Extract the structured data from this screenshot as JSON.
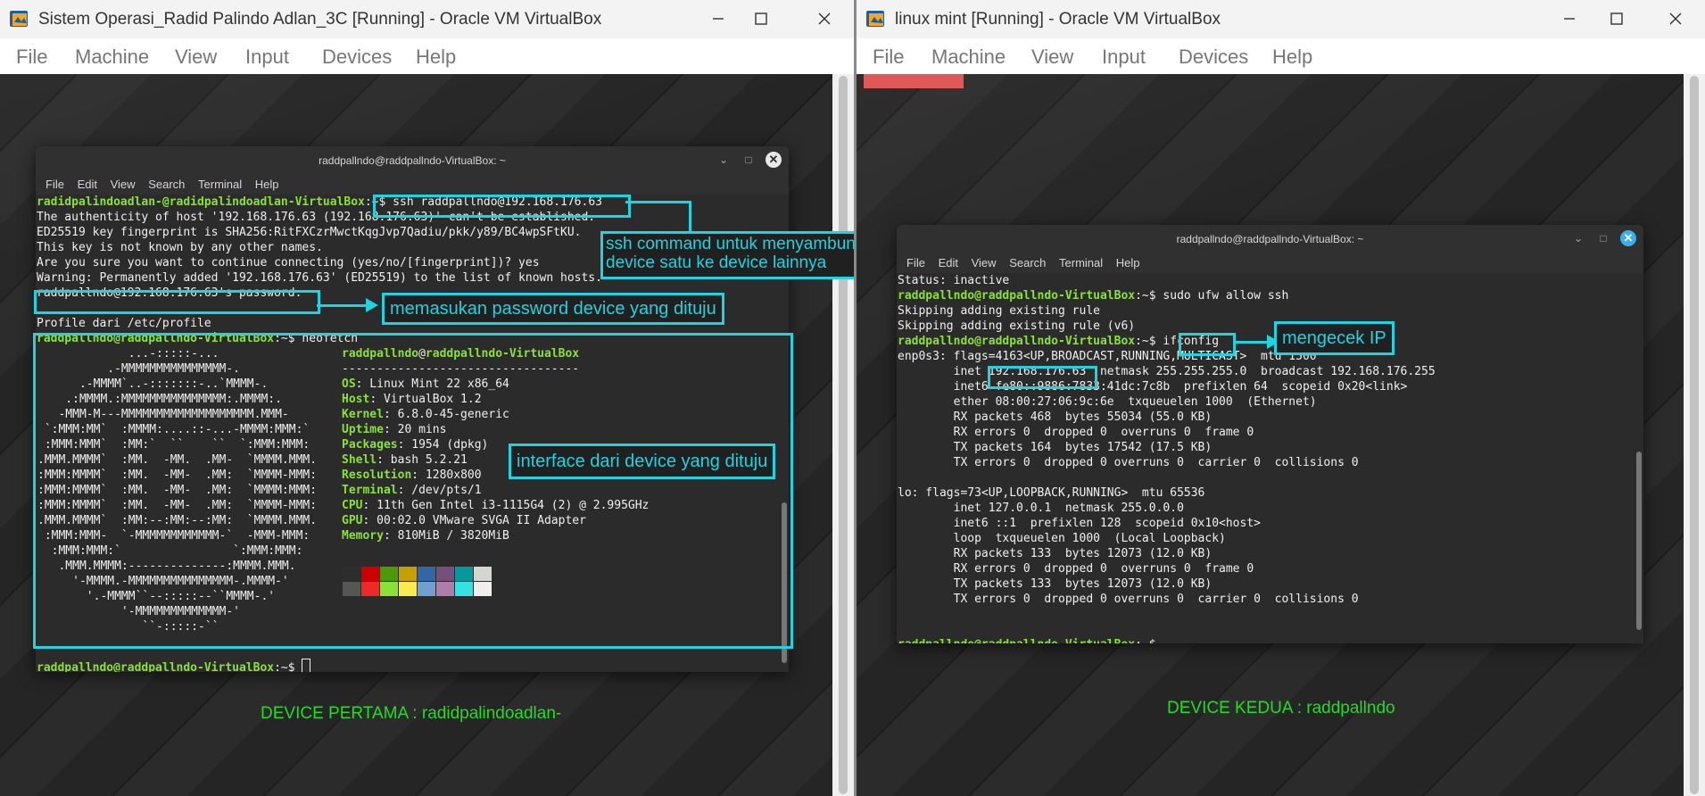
{
  "vm1": {
    "title": "Sistem Operasi_Radid Palindo Adlan_3C [Running] - Oracle VM VirtualBox",
    "menu": [
      "File",
      "Machine",
      "View",
      "Input",
      "Devices",
      "Help"
    ],
    "terminal": {
      "title": "raddpallndo@raddpallndo-VirtualBox: ~",
      "menu": [
        "File",
        "Edit",
        "View",
        "Search",
        "Terminal",
        "Help"
      ],
      "prompt_user1": "radidpalindoadlan-@radidpalindoadlan-VirtualBox",
      "prompt_sep": ":~$",
      "cmd_ssh": " ssh raddpallndo@192.168.176.63",
      "out1": "The authenticity of host '192.168.176.63 (192.168.176.63)' can't be established.",
      "out2": "ED25519 key fingerprint is SHA256:RitFXCzrMwctKqgJvp7Qadiu/pkk/y89/BC4wpSFtKU.",
      "out3": "This key is not known by any other names.",
      "out4": "Are you sure you want to continue connecting (yes/no/[fingerprint])? yes",
      "out5": "Warning: Permanently added '192.168.176.63' (ED25519) to the list of known hosts.",
      "out6": "raddpallndo@192.168.176.63's password:",
      "out7": "Profile dari /etc/profile",
      "prompt_user2": "raddpallndo@raddpallndo-VirtualBox",
      "cmd_neofetch": " neofetch",
      "neo_header_user": "raddpallndo",
      "neo_header_at": "@",
      "neo_header_host": "raddpallndo-VirtualBox",
      "neo_rule": "----------------------------------",
      "neo_info": [
        {
          "k": "OS",
          "v": ": Linux Mint 22 x86_64"
        },
        {
          "k": "Host",
          "v": ": VirtualBox 1.2"
        },
        {
          "k": "Kernel",
          "v": ": 6.8.0-45-generic"
        },
        {
          "k": "Uptime",
          "v": ": 20 mins"
        },
        {
          "k": "Packages",
          "v": ": 1954 (dpkg)"
        },
        {
          "k": "Shell",
          "v": ": bash 5.2.21"
        },
        {
          "k": "Resolution",
          "v": ": 1280x800"
        },
        {
          "k": "Terminal",
          "v": ": /dev/pts/1"
        },
        {
          "k": "CPU",
          "v": ": 11th Gen Intel i3-1115G4 (2) @ 2.995GHz"
        },
        {
          "k": "GPU",
          "v": ": 00:02.0 VMware SVGA II Adapter"
        },
        {
          "k": "Memory",
          "v": ": 810MiB / 3820MiB"
        }
      ],
      "ascii": [
        "             ...-:::::-...",
        "          .-MMMMMMMMMMMMMMM-.",
        "      .-MMMM`..-:::::::-..`MMMM-.",
        "    .:MMMM.:MMMMMMMMMMMMMMM:.MMMM:.",
        "   -MMM-M---MMMMMMMMMMMMMMMMMMM.MMM-",
        " `:MMM:MM`  :MMMM:....::-...-MMMM:MMM:`",
        " :MMM:MMM`  :MM:`  ``    ``  `:MMM:MMM:",
        ".MMM.MMMM`  :MM.  -MM.  .MM-  `MMMM.MMM.",
        ":MMM:MMMM`  :MM.  -MM-  .MM:  `MMMM-MMM:",
        ":MMM:MMMM`  :MM.  -MM-  .MM:  `MMMM:MMM:",
        ":MMM:MMMM`  :MM.  -MM-  .MM:  `MMMM-MMM:",
        ".MMM.MMMM`  :MM:--:MM:--:MM:  `MMMM.MMM.",
        " :MMM:MMM-  `-MMMMMMMMMMMM-`  -MMM-MMM:",
        "  :MMM:MMM:`                `:MMM:MMM:",
        "   .MMM.MMMM:--------------:MMMM.MMM.",
        "     '-MMMM.-MMMMMMMMMMMMMMM-.MMMM-'",
        "       '.-MMMM``--:::::--``MMMM-.'",
        "            '-MMMMMMMMMMMMM-'",
        "               ``-:::::-``"
      ],
      "final_prompt_user": "raddpallndo@raddpallndo-VirtualBox",
      "palette_top": [
        "#2d2d2d",
        "#cc0000",
        "#4e9a06",
        "#c4a000",
        "#3465a4",
        "#75507b",
        "#06989a",
        "#d3d7cf"
      ],
      "palette_bottom": [
        "#555753",
        "#ef2929",
        "#8ae234",
        "#fce94f",
        "#729fcf",
        "#ad7fa8",
        "#34e2e2",
        "#eeeeec"
      ]
    },
    "callout_ssh": "ssh command untuk menyambungkan\ndevice satu ke device lainnya",
    "callout_ssh_line1": "ssh command untuk menyambungkan",
    "callout_ssh_line2": "device satu ke device lainnya",
    "callout_password": "memasukan password device yang dituju",
    "callout_interface": "interface dari device yang dituju",
    "device_label": "DEVICE PERTAMA : radidpalindoadlan-"
  },
  "vm2": {
    "title": "linux mint [Running] - Oracle VM VirtualBox",
    "menu": [
      "File",
      "Machine",
      "View",
      "Input",
      "Devices",
      "Help"
    ],
    "terminal": {
      "title": "raddpallndo@raddpallndo-VirtualBox: ~",
      "menu": [
        "File",
        "Edit",
        "View",
        "Search",
        "Terminal",
        "Help"
      ],
      "l1": "Status: inactive",
      "prompt_user": "raddpallndo@raddpallndo-VirtualBox",
      "prompt_sep": ":~$",
      "cmd_ufw": " sudo ufw allow ssh",
      "l3": "Skipping adding existing rule",
      "l4": "Skipping adding existing rule (v6)",
      "cmd_ifconfig": " ifconfig",
      "enp_head": "enp0s3: flags=4163<UP,BROADCAST,RUNNING,MULTICAST>  mtu 1500",
      "inet_pre": "        inet ",
      "inet_ip": "192.168.176.63",
      "inet_post": "  netmask 255.255.255.0  broadcast 192.168.176.255",
      "enp_rest": [
        "        inet6 fe80::9886:7833:41dc:7c8b  prefixlen 64  scopeid 0x20<link>",
        "        ether 08:00:27:06:9c:6e  txqueuelen 1000  (Ethernet)",
        "        RX packets 468  bytes 55034 (55.0 KB)",
        "        RX errors 0  dropped 0  overruns 0  frame 0",
        "        TX packets 164  bytes 17542 (17.5 KB)",
        "        TX errors 0  dropped 0 overruns 0  carrier 0  collisions 0",
        "",
        "lo: flags=73<UP,LOOPBACK,RUNNING>  mtu 65536",
        "        inet 127.0.0.1  netmask 255.0.0.0",
        "        inet6 ::1  prefixlen 128  scopeid 0x10<host>",
        "        loop  txqueuelen 1000  (Local Loopback)",
        "        RX packets 133  bytes 12073 (12.0 KB)",
        "        RX errors 0  dropped 0  overruns 0  frame 0",
        "        TX packets 133  bytes 12073 (12.0 KB)",
        "        TX errors 0  dropped 0 overruns 0  carrier 0  collisions 0"
      ]
    },
    "callout_ip": "mengecek IP",
    "device_label": "DEVICE KEDUA : raddpallndo"
  }
}
